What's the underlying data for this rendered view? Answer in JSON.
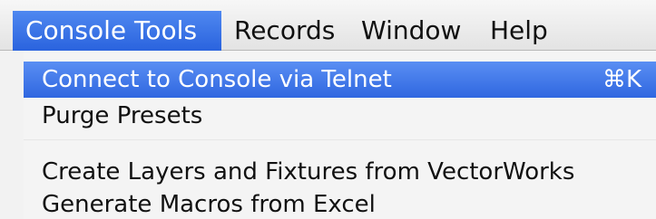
{
  "menubar": {
    "items": [
      {
        "label": "Console Tools"
      },
      {
        "label": "Records"
      },
      {
        "label": "Window"
      },
      {
        "label": "Help"
      }
    ]
  },
  "dropdown": {
    "items": [
      {
        "label": "Connect to Console via Telnet",
        "shortcut": "⌘K"
      },
      {
        "label": "Purge Presets"
      },
      {
        "label": "Create Layers and Fixtures from VectorWorks"
      },
      {
        "label": "Generate Macros from Excel"
      }
    ]
  },
  "colors": {
    "highlight": "#3b74e6",
    "menu_bg": "#f4f4f4"
  }
}
